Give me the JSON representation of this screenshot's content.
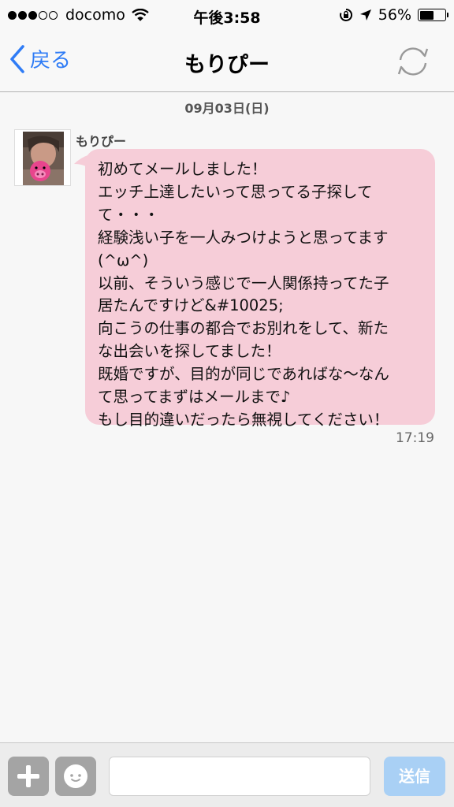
{
  "status_bar": {
    "carrier": "docomo",
    "time": "午後3:58",
    "battery_percent": "56%",
    "battery_level": 0.56
  },
  "nav": {
    "back_label": "戻る",
    "title": "もりぴー"
  },
  "conversation": {
    "date": "09月03日(日)",
    "sender": "もりぴー",
    "message_lines": [
      "初めてメールしました！",
      "エッチ上達したいって思ってる子探して",
      "て・・・",
      "経験浅い子を一人みつけようと思ってます",
      "(^ω^)",
      "以前、そういう感じで一人関係持ってた子",
      "居たんですけど&#10025;",
      "向こうの仕事の都合でお別れをして、新た",
      "な出会いを探してました！",
      "既婚ですが、目的が同じであればな〜なん",
      "て思ってまずはメールまで♪",
      "もし目的違いだったら無視してください！"
    ],
    "time": "17:19"
  },
  "toolbar": {
    "input_value": "",
    "send_label": "送信"
  },
  "colors": {
    "accent": "#2f7cf6",
    "bubble": "#f6cdd8",
    "send_button": "#a9d0f5"
  }
}
